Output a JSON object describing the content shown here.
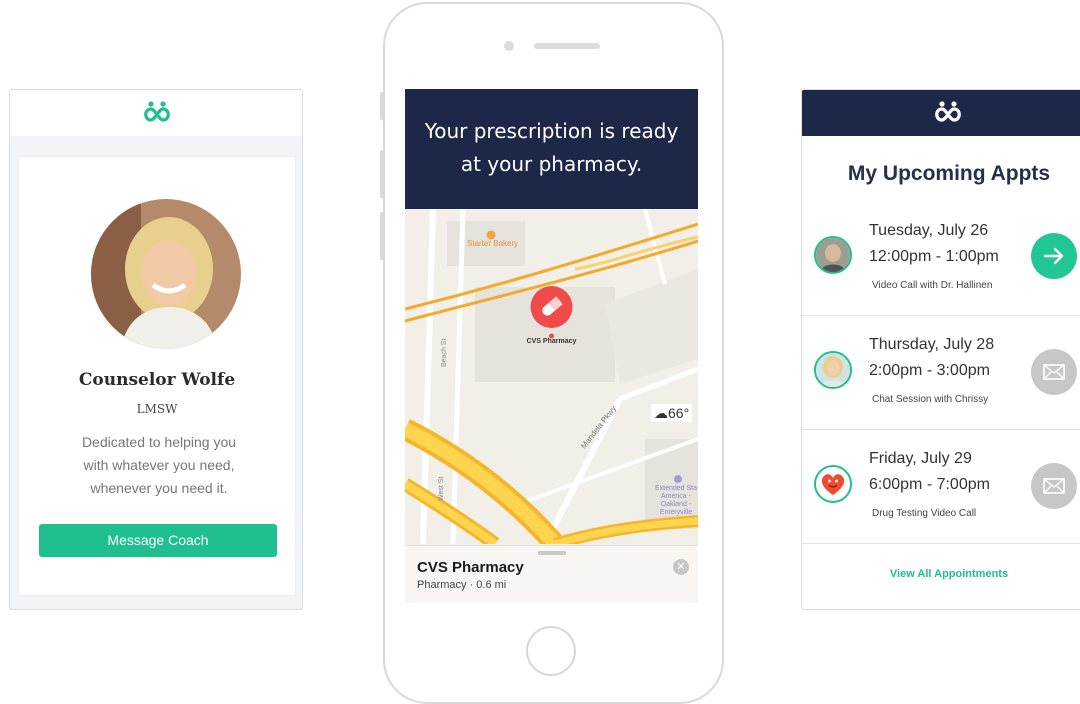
{
  "brand": {
    "accent": "#1fbf8f",
    "navy": "#1d2848",
    "logo_icon": "infinity-people-logo"
  },
  "coach_card": {
    "name": "Counselor Wolfe",
    "credential": "LMSW",
    "description": "Dedicated to helping you with whatever you need, whenever you need it.",
    "message_button": "Message Coach"
  },
  "phone": {
    "notification": {
      "line1": "Your prescription is ready",
      "line2": "at your pharmacy."
    },
    "map": {
      "pin_label": "CVS Pharmacy",
      "poi_bakery": "Starter Bakery",
      "street_beach": "Beach St",
      "street_mandela": "Mandela Pkwy",
      "street_west": "West St",
      "poi_hotel_lines": [
        "Extended Sta",
        "America -",
        "Oakland -",
        "Emeryville"
      ],
      "weather": "66°",
      "weather_icon": "cloud-icon"
    },
    "place": {
      "name": "CVS Pharmacy",
      "subtitle": "Pharmacy · 0.6 mi"
    }
  },
  "appointments_card": {
    "title": "My Upcoming Appts",
    "items": [
      {
        "date": "Tuesday, July 26",
        "time": "12:00pm - 1:00pm",
        "desc": "Video Call with Dr. Hallinen",
        "action_icon": "arrow-right-icon"
      },
      {
        "date": "Thursday, July 28",
        "time": "2:00pm - 3:00pm",
        "desc": "Chat Session with Chrissy",
        "action_icon": "mail-icon"
      },
      {
        "date": "Friday, July 29",
        "time": "6:00pm - 7:00pm",
        "desc": "Drug Testing Video Call",
        "action_icon": "mail-icon"
      }
    ],
    "view_all": "View All Appointments"
  }
}
